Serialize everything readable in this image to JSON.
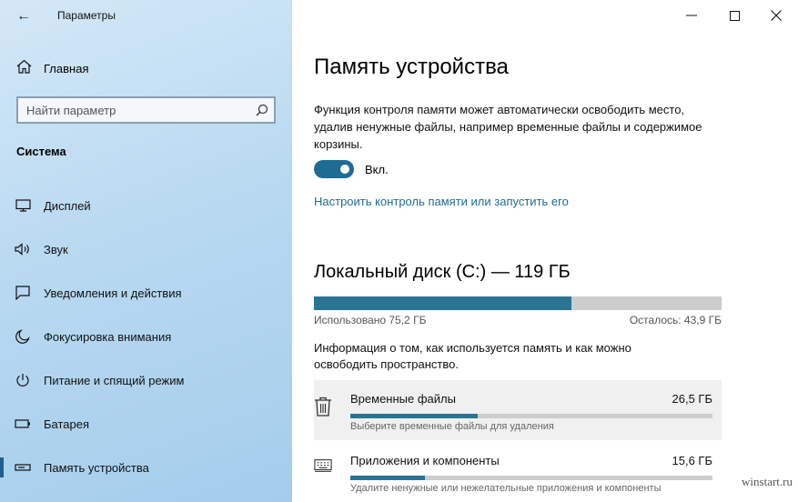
{
  "window": {
    "title": "Параметры",
    "controls": {
      "minimize": "─",
      "maximize": "☐",
      "close": "✕"
    }
  },
  "sidebar": {
    "back_icon": "←",
    "home_label": "Главная",
    "search_placeholder": "Найти параметр",
    "section_title": "Система",
    "items": [
      {
        "label": "Дисплей",
        "icon": "monitor-icon"
      },
      {
        "label": "Звук",
        "icon": "speaker-icon"
      },
      {
        "label": "Уведомления и действия",
        "icon": "notification-icon"
      },
      {
        "label": "Фокусировка внимания",
        "icon": "moon-icon"
      },
      {
        "label": "Питание и спящий режим",
        "icon": "power-icon"
      },
      {
        "label": "Батарея",
        "icon": "battery-icon"
      },
      {
        "label": "Память устройства",
        "icon": "storage-icon",
        "active": true
      }
    ]
  },
  "main": {
    "title": "Память устройства",
    "description": "Функция контроля памяти может автоматически освободить место, удалив ненужные файлы, например временные файлы и содержимое корзины.",
    "toggle_state": "Вкл.",
    "configure_link": "Настроить контроль памяти или запустить его",
    "disk": {
      "title": "Локальный диск (C:) — 119 ГБ",
      "used_label": "Использовано 75,2 ГБ",
      "free_label": "Осталось: 43,9 ГБ",
      "used_fraction": 0.632
    },
    "info": "Информация о том, как используется память и как можно освободить пространство.",
    "categories": [
      {
        "name": "Временные файлы",
        "size": "26,5 ГБ",
        "desc": "Выберите временные файлы для удаления",
        "fraction": 0.352,
        "icon": "trash-icon"
      },
      {
        "name": "Приложения и компоненты",
        "size": "15,6 ГБ",
        "desc": "Удалите ненужные или нежелательные приложения и компоненты",
        "fraction": 0.207,
        "icon": "keyboard-icon"
      }
    ]
  },
  "watermark": "winstart.ru",
  "colors": {
    "accent": "#1f6b93",
    "bar_fill": "#2a7494",
    "bar_bg": "#cdcdcd"
  }
}
